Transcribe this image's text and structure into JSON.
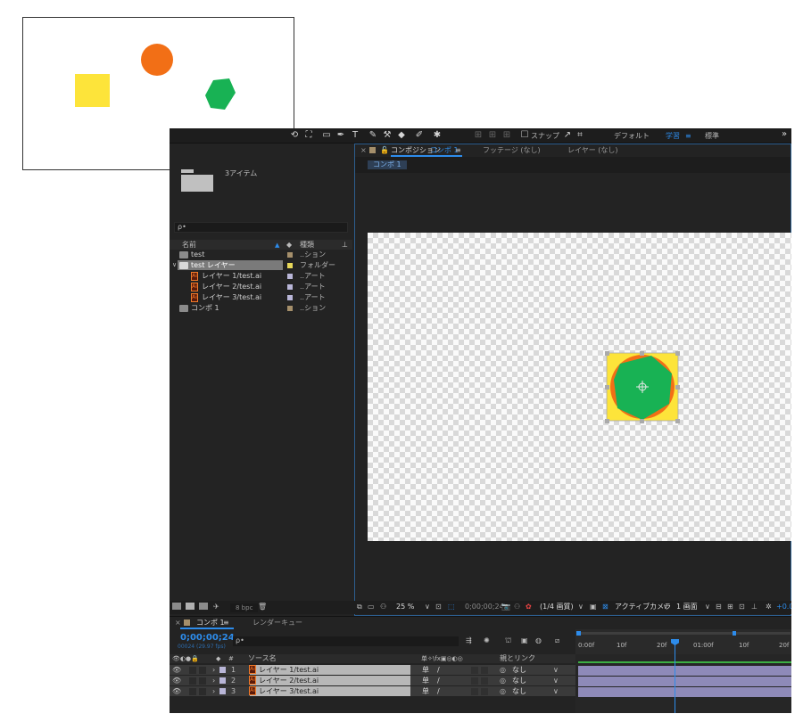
{
  "toolbar": {
    "snap_label": "スナップ",
    "workspace_default": "デフォルト",
    "workspace_learn": "学習",
    "workspace_standard": "標準",
    "overflow": "»"
  },
  "project": {
    "item_count": "3アイテム",
    "search_placeholder": "ρ•",
    "col_name": "名前",
    "col_type": "種類",
    "items": [
      {
        "name": "test",
        "type": "..ション",
        "swatch": "#a58f6b",
        "kind": "folder"
      },
      {
        "name": "test レイヤー",
        "type": "フォルダー",
        "swatch": "#e8d85a",
        "kind": "folder"
      },
      {
        "name": "レイヤー 1/test.ai",
        "type": "..アート",
        "swatch": "#b9b6d8",
        "kind": "ai"
      },
      {
        "name": "レイヤー 2/test.ai",
        "type": "..アート",
        "swatch": "#b9b6d8",
        "kind": "ai"
      },
      {
        "name": "レイヤー 3/test.ai",
        "type": "..アート",
        "swatch": "#b9b6d8",
        "kind": "ai"
      },
      {
        "name": "コンポ 1",
        "type": "..ション",
        "swatch": "#a58f6b",
        "kind": "comp"
      }
    ],
    "bpc": "8 bpc"
  },
  "composition": {
    "tab_prefix": "コンポジション",
    "tab_name": "コンポ 1",
    "footage_tab": "フッテージ (なし)",
    "layer_tab": "レイヤー (なし)",
    "breadcrumb": "コンポ 1",
    "zoom": "25 %",
    "timecode": "0;00;00;24",
    "resolution": "(1/4 画質)",
    "camera": "アクティブカメラ",
    "views": "1 画面",
    "exposure": "+0.0"
  },
  "timeline": {
    "tab_name": "コンポ 1",
    "render_queue": "レンダーキュー",
    "timecode": "0;00;00;24",
    "frame_info": "00024 (29.97 fps)",
    "search_placeholder": "ρ•",
    "col_source": "ソース名",
    "col_parent": "親とリンク",
    "ruler": [
      "0:00f",
      "10f",
      "20f",
      "01:00f",
      "10f",
      "20f"
    ],
    "layers": [
      {
        "num": "1",
        "name": "レイヤー 1/test.ai",
        "parent": "なし"
      },
      {
        "num": "2",
        "name": "レイヤー 2/test.ai",
        "parent": "なし"
      },
      {
        "num": "3",
        "name": "レイヤー 3/test.ai",
        "parent": "なし"
      }
    ]
  },
  "colors": {
    "shape_yellow": "#fde43a",
    "shape_orange": "#f26f16",
    "shape_green": "#18b254",
    "accent_blue": "#2d8ceb",
    "label_lavender": "#b9b6d8"
  }
}
